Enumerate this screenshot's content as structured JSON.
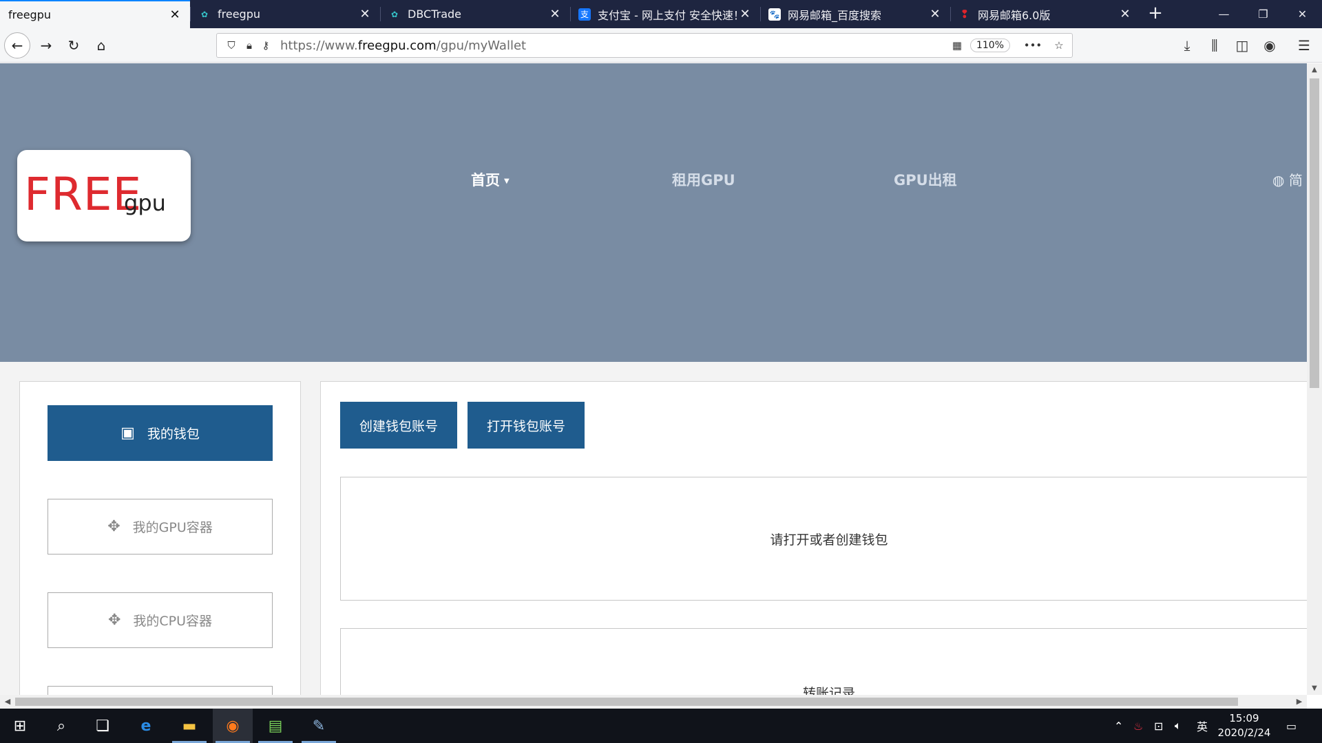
{
  "browser": {
    "tabs": [
      {
        "title": "freegpu",
        "active": true,
        "favicon": "none"
      },
      {
        "title": "freegpu",
        "active": false,
        "favicon": "brain-icon"
      },
      {
        "title": "DBCTrade",
        "active": false,
        "favicon": "brain-icon"
      },
      {
        "title": "支付宝 - 网上支付 安全快速！",
        "active": false,
        "favicon": "alipay-icon"
      },
      {
        "title": "网易邮箱_百度搜索",
        "active": false,
        "favicon": "baidu-icon"
      },
      {
        "title": "网易邮箱6.0版",
        "active": false,
        "favicon": "netease-icon"
      }
    ],
    "url_prefix": "https://www.",
    "url_domain": "freegpu.com",
    "url_path": "/gpu/myWallet",
    "zoom": "110%"
  },
  "site": {
    "logo_big": "FREE",
    "logo_small": "gpu",
    "nav": {
      "home": "首页",
      "rent_gpu": "租用GPU",
      "gpu_lease": "GPU出租",
      "language": "简"
    },
    "sidebar": {
      "my_wallet": "我的钱包",
      "my_gpu_container": "我的GPU容器",
      "my_cpu_container": "我的CPU容器"
    },
    "main": {
      "create_wallet": "创建钱包账号",
      "open_wallet": "打开钱包账号",
      "wallet_prompt": "请打开或者创建钱包",
      "transfer_history": "转账记录"
    }
  },
  "taskbar": {
    "time": "15:09",
    "date": "2020/2/24",
    "ime": "英"
  },
  "colors": {
    "hero": "#798ca3",
    "primary_button": "#1f5c8e",
    "logo_red": "#de2a2f",
    "tabstrip": "#1e2540"
  }
}
